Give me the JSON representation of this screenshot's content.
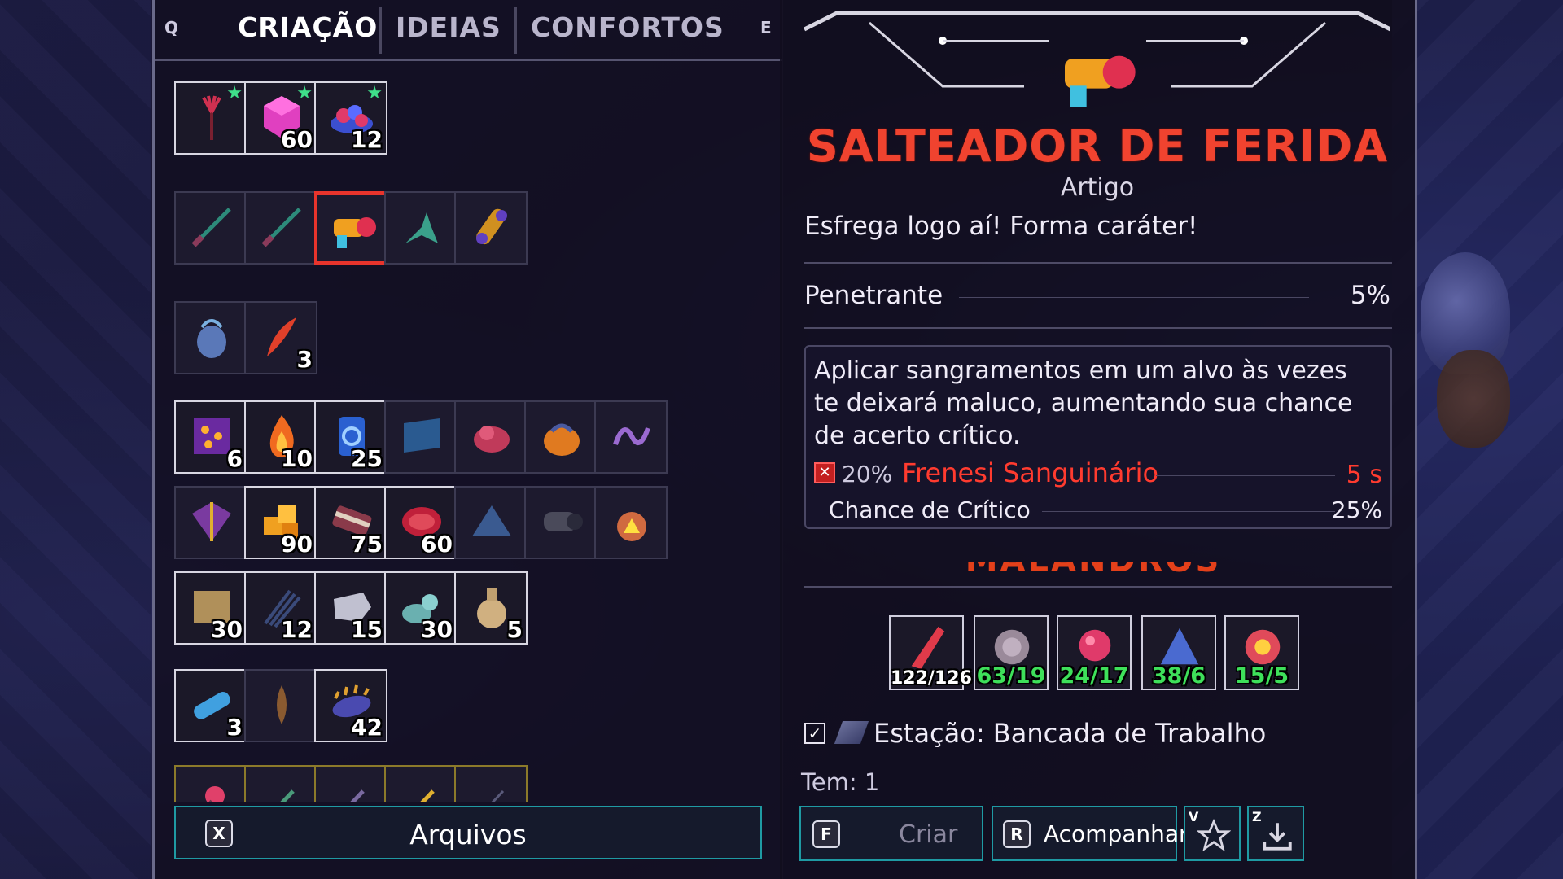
{
  "tabs": {
    "left_key": "Q",
    "right_key": "E",
    "items": [
      {
        "label": "CRIAÇÃO",
        "active": true
      },
      {
        "label": "IDEIAS",
        "active": false
      },
      {
        "label": "CONFORTOS",
        "active": false
      }
    ]
  },
  "grid": {
    "row1": [
      {
        "icon": "red-plant-icon",
        "count": "",
        "starred": true
      },
      {
        "icon": "pink-crystal-icon",
        "count": "60",
        "starred": true
      },
      {
        "icon": "blue-berries-icon",
        "count": "12",
        "starred": true
      }
    ],
    "row2": [
      {
        "icon": "dagger-icon",
        "count": ""
      },
      {
        "icon": "dagger-icon",
        "count": ""
      },
      {
        "icon": "wound-gun-icon",
        "count": "",
        "selected": true
      },
      {
        "icon": "twin-blades-icon",
        "count": ""
      },
      {
        "icon": "tube-gadget-icon",
        "count": ""
      }
    ],
    "row3": [
      {
        "icon": "spirit-flask-icon",
        "count": ""
      },
      {
        "icon": "red-feather-icon",
        "count": "3"
      }
    ],
    "row4": [
      {
        "icon": "gem-box-icon",
        "count": "6"
      },
      {
        "icon": "flame-icon",
        "count": "10"
      },
      {
        "icon": "blue-canister-icon",
        "count": "25"
      },
      {
        "icon": "blue-panel-icon",
        "count": ""
      },
      {
        "icon": "pink-blob-icon",
        "count": ""
      },
      {
        "icon": "orange-bag-icon",
        "count": ""
      },
      {
        "icon": "purple-vine-icon",
        "count": ""
      }
    ],
    "row5": [
      {
        "icon": "wrapped-package-icon",
        "count": ""
      },
      {
        "icon": "orange-cubes-icon",
        "count": "90"
      },
      {
        "icon": "fabric-roll-icon",
        "count": "75"
      },
      {
        "icon": "red-coral-icon",
        "count": "60"
      },
      {
        "icon": "blue-pyramid-icon",
        "count": ""
      },
      {
        "icon": "metal-cylinder-icon",
        "count": ""
      },
      {
        "icon": "hazard-flask-icon",
        "count": ""
      }
    ],
    "row6": [
      {
        "icon": "cardboard-icon",
        "count": "30"
      },
      {
        "icon": "fiber-bundle-icon",
        "count": "12"
      },
      {
        "icon": "stone-slab-icon",
        "count": "15"
      },
      {
        "icon": "teal-ore-icon",
        "count": "30"
      },
      {
        "icon": "clay-jug-icon",
        "count": "5"
      }
    ],
    "row7": [
      {
        "icon": "ice-tube-icon",
        "count": "3"
      },
      {
        "icon": "brown-root-icon",
        "count": ""
      },
      {
        "icon": "spiky-larva-icon",
        "count": "42"
      }
    ],
    "row8": [
      {
        "icon": "pink-rose-icon",
        "count": ""
      },
      {
        "icon": "green-sprig-icon",
        "count": ""
      },
      {
        "icon": "purple-twig-icon",
        "count": ""
      },
      {
        "icon": "gold-arrow-icon",
        "count": ""
      },
      {
        "icon": "thin-stick-icon",
        "count": ""
      }
    ]
  },
  "archive": {
    "key": "X",
    "label": "Arquivos"
  },
  "item": {
    "name": "SALTEADOR DE FERIDA",
    "rarity": "Artigo",
    "description": "Esfrega logo aí! Forma caráter!",
    "stat_name": "Penetrante",
    "stat_value": "5%",
    "effect_text": "Aplicar sangramentos em um alvo às vezes te deixará maluco, aumentando sua chance de acerto crítico.",
    "effect_chance": "20%",
    "effect_name": "Frenesi Sanguinário",
    "effect_duration": "5 s",
    "crit_label": "Chance de Crítico",
    "crit_value": "25%",
    "ingredients_header": "MALANDROS"
  },
  "ingredients": [
    {
      "icon": "red-fang-icon",
      "amount": "122/126"
    },
    {
      "icon": "gray-rose-icon",
      "amount": "63/19"
    },
    {
      "icon": "pink-spore-icon",
      "amount": "24/17"
    },
    {
      "icon": "blue-pebbles-icon",
      "amount": "38/6"
    },
    {
      "icon": "flower-bloom-icon",
      "amount": "15/5"
    }
  ],
  "station": {
    "label": "Estação: Bancada de Trabalho",
    "checked": true
  },
  "have": "Tem: 1",
  "buttons": {
    "craft": {
      "key": "F",
      "label": "Criar"
    },
    "track": {
      "key": "R",
      "label": "Acompanhar"
    },
    "favorite_key": "V",
    "download_key": "Z"
  },
  "colors": {
    "title_red": "#f0432f",
    "accent_cyan": "#1f9aa3",
    "ok_green": "#3ee05a",
    "star_green": "#3fe08a"
  }
}
